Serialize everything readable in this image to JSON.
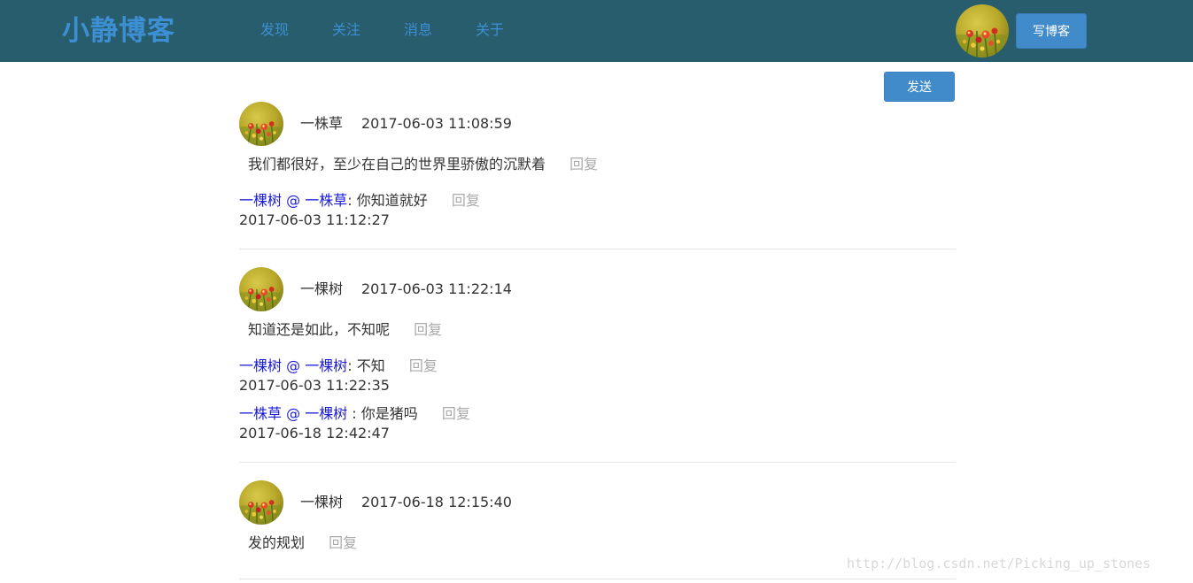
{
  "nav": {
    "brand": "小静博客",
    "links": [
      "发现",
      "关注",
      "消息",
      "关于"
    ],
    "write_button": "写博客"
  },
  "send_button": "发送",
  "reply_label": "回复",
  "comments": [
    {
      "author": "一株草",
      "time": "2017-06-03 11:08:59",
      "text": "我们都很好，至少在自己的世界里骄傲的沉默着",
      "replies": [
        {
          "from": "一棵树",
          "at": "@",
          "to": "一株草",
          "sep": ": ",
          "text": "你知道就好",
          "time": "2017-06-03 11:12:27"
        }
      ]
    },
    {
      "author": "一棵树",
      "time": "2017-06-03 11:22:14",
      "text": "知道还是如此，不知呢",
      "replies": [
        {
          "from": "一棵树",
          "at": "@",
          "to": "一棵树",
          "sep": ": ",
          "text": "不知",
          "time": "2017-06-03 11:22:35"
        },
        {
          "from": "一株草",
          "at": "@",
          "to": "一棵树",
          "sep": " : ",
          "text": "你是猪吗",
          "time": "2017-06-18 12:42:47"
        }
      ]
    },
    {
      "author": "一棵树",
      "time": "2017-06-18 12:15:40",
      "text": "发的规划",
      "replies": []
    }
  ],
  "watermark": "http://blog.csdn.net/Picking_up_stones",
  "colors": {
    "navbar_bg": "#285d6e",
    "brand": "#3d8fd4",
    "button": "#428bca",
    "reply_user": "#1a1adb",
    "reply_link": "#aaaaaa"
  },
  "icons": {
    "avatar": "flower-avatar-image"
  }
}
